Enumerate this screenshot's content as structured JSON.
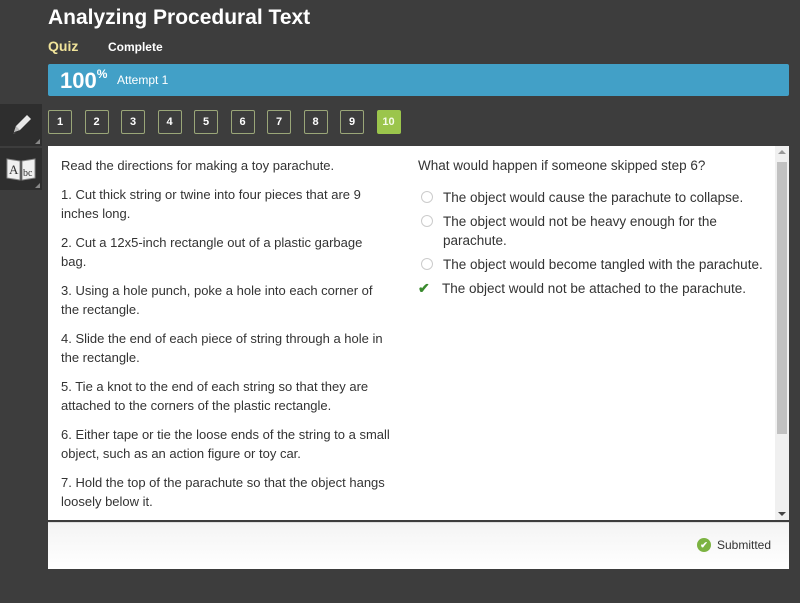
{
  "header": {
    "title": "Analyzing Procedural Text",
    "type": "Quiz",
    "status": "Complete"
  },
  "progress": {
    "score": "100",
    "percent_symbol": "%",
    "attempt": "Attempt 1",
    "color": "#42a0c7"
  },
  "tools": [
    {
      "name": "pencil"
    },
    {
      "name": "dictionary"
    }
  ],
  "question_nav": {
    "items": [
      "1",
      "2",
      "3",
      "4",
      "5",
      "6",
      "7",
      "8",
      "9",
      "10"
    ],
    "active": "10"
  },
  "passage": {
    "intro": "Read the directions for making a toy parachute.",
    "steps": [
      "1. Cut thick string or twine into four pieces that are 9 inches long.",
      "2. Cut a 12x5-inch rectangle out of a plastic garbage bag.",
      "3. Using a hole punch, poke a hole into each corner of the rectangle.",
      "4. Slide the end of each piece of string through a hole in the rectangle.",
      "5. Tie a knot to the end of each string so that they are attached to the corners of the plastic rectangle.",
      "6. Either tape or tie the loose ends of the string to a small object, such as an action figure or toy car.",
      "7. Hold the top of the parachute so that the object hangs loosely below it."
    ]
  },
  "question": {
    "prompt": "What would happen if someone skipped step 6?",
    "options": [
      {
        "text": "The object would cause the parachute to collapse.",
        "selected": false
      },
      {
        "text": "The object would not be heavy enough for the parachute.",
        "selected": false
      },
      {
        "text": "The object would become tangled with the parachute.",
        "selected": false
      },
      {
        "text": "The object would not be attached to the parachute.",
        "selected": true
      }
    ]
  },
  "footer": {
    "status": "Submitted"
  }
}
